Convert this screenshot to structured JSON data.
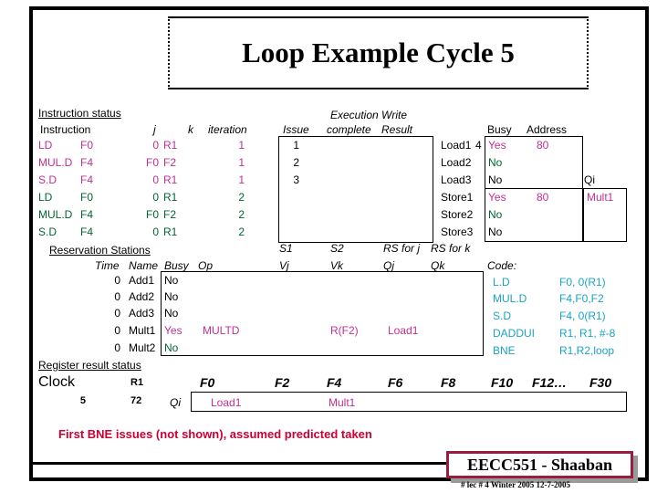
{
  "title": "Loop Example Cycle 5",
  "instruction_status": {
    "section_label": "Instruction status",
    "headers": {
      "instruction": "Instruction",
      "j": "j",
      "k": "k",
      "iteration": "iteration",
      "issue": "Issue",
      "execution": "Execution",
      "complete": "complete",
      "write": "Write",
      "result": "Result"
    },
    "rows": [
      {
        "op": "LD",
        "dest": "F0",
        "j": "0",
        "k": "R1",
        "iteration": "1",
        "color": "magenta"
      },
      {
        "op": "MUL.D",
        "dest": "F4",
        "j": "F0",
        "k": "F2",
        "iteration": "1",
        "color": "magenta"
      },
      {
        "op": "S.D",
        "dest": "F4",
        "j": "0",
        "k": "R1",
        "iteration": "1",
        "color": "magenta"
      },
      {
        "op": "LD",
        "dest": "F0",
        "j": "0",
        "k": "R1",
        "iteration": "2",
        "color": "green"
      },
      {
        "op": "MUL.D",
        "dest": "F4",
        "j": "F0",
        "k": "F2",
        "iteration": "2",
        "color": "green"
      },
      {
        "op": "S.D",
        "dest": "F4",
        "j": "0",
        "k": "R1",
        "iteration": "2",
        "color": "green"
      }
    ],
    "issue_values": [
      "1",
      "2",
      "3"
    ]
  },
  "load_store_buffers": {
    "headers": {
      "busy": "Busy",
      "address": "Address",
      "qi": "Qi"
    },
    "rows": [
      {
        "name": "Load1",
        "time": "4",
        "busy": "Yes",
        "address": "80",
        "qi": "",
        "color": "magenta"
      },
      {
        "name": "Load2",
        "time": "",
        "busy": "No",
        "address": "",
        "qi": "",
        "color": "green"
      },
      {
        "name": "Load3",
        "time": "",
        "busy": "No",
        "address": "",
        "qi": "",
        "color": "black"
      },
      {
        "name": "Store1",
        "time": "",
        "busy": "Yes",
        "address": "80",
        "qi": "Mult1",
        "color": "magenta"
      },
      {
        "name": "Store2",
        "time": "",
        "busy": "No",
        "address": "",
        "qi": "",
        "color": "green"
      },
      {
        "name": "Store3",
        "time": "",
        "busy": "No",
        "address": "",
        "qi": "",
        "color": "black"
      }
    ]
  },
  "reservation_stations": {
    "section_label": "Reservation Stations",
    "headers": {
      "time": "Time",
      "name": "Name",
      "busy": "Busy",
      "op": "Op",
      "s1": "S1",
      "s2": "S2",
      "vj": "Vj",
      "vk": "Vk",
      "rs_for_j": "RS for j",
      "rs_for_k": "RS for k",
      "qj": "Qj",
      "qk": "Qk"
    },
    "rows": [
      {
        "time": "0",
        "name": "Add1",
        "busy": "No",
        "op": "",
        "vj": "",
        "vk": "",
        "qj": "",
        "qk": "",
        "color": "black"
      },
      {
        "time": "0",
        "name": "Add2",
        "busy": "No",
        "op": "",
        "vj": "",
        "vk": "",
        "qj": "",
        "qk": "",
        "color": "black"
      },
      {
        "time": "0",
        "name": "Add3",
        "busy": "No",
        "op": "",
        "vj": "",
        "vk": "",
        "qj": "",
        "qk": "",
        "color": "black"
      },
      {
        "time": "0",
        "name": "Mult1",
        "busy": "Yes",
        "op": "MULTD",
        "vj": "",
        "vk": "R(F2)",
        "qj": "Load1",
        "qk": "",
        "color": "magenta"
      },
      {
        "time": "0",
        "name": "Mult2",
        "busy": "No",
        "op": "",
        "vj": "",
        "vk": "",
        "qj": "",
        "qk": "",
        "color": "green"
      }
    ]
  },
  "code": {
    "label": "Code:",
    "lines": [
      {
        "op": "L.D",
        "operands": "F0, 0(R1)"
      },
      {
        "op": "MUL.D",
        "operands": "F4,F0,F2"
      },
      {
        "op": "S.D",
        "operands": "F4, 0(R1)"
      },
      {
        "op": "DADDUI",
        "operands": "R1, R1, #-8"
      },
      {
        "op": "BNE",
        "operands": "R1,R2,loop"
      }
    ]
  },
  "register_result_status": {
    "section_label": "Register result status",
    "clock_label": "Clock",
    "clock_value": "5",
    "r1_label": "R1",
    "r1_value": "72",
    "qi_label": "Qi",
    "registers": [
      "F0",
      "F2",
      "F4",
      "F6",
      "F8",
      "F10",
      "F12…",
      "F30"
    ],
    "values": [
      {
        "reg": "F0",
        "value": "Load1",
        "color": "magenta"
      },
      {
        "reg": "F4",
        "value": "Mult1",
        "color": "magenta"
      }
    ]
  },
  "bottom_note": "First  BNE  issues  (not shown), assumed predicted taken",
  "footer": {
    "badge": "EECC551 - Shaaban",
    "subtitle": "#  lec # 4   Winter 2005    12-7-2005"
  },
  "colors": {
    "magenta": "#C03090",
    "green": "#006633",
    "cyan": "#1BA3C6",
    "red": "#CC0033",
    "badge_border": "#9B1C3C"
  }
}
